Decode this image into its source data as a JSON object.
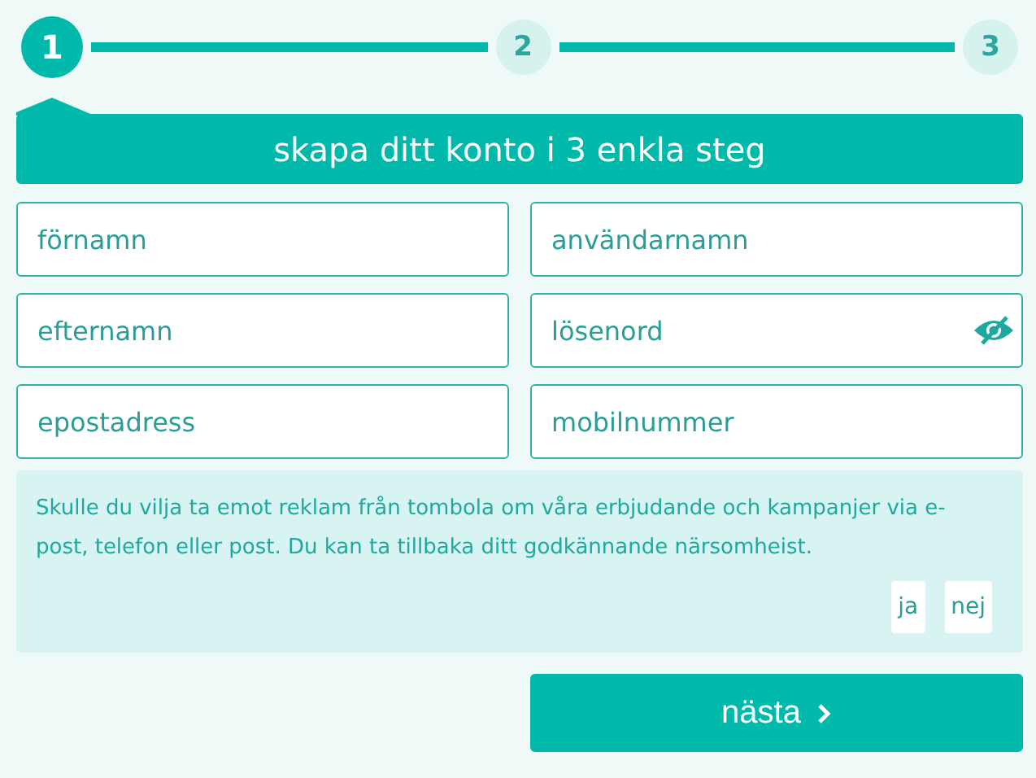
{
  "steps": [
    {
      "label": "1",
      "selected": true
    },
    {
      "label": "2",
      "selected": false
    },
    {
      "label": "3",
      "selected": false
    }
  ],
  "header": {
    "title": "skapa ditt konto i 3 enkla steg"
  },
  "fields": [
    {
      "placeholder": "förnamn",
      "kind": "text"
    },
    {
      "placeholder": "användarnamn",
      "kind": "text"
    },
    {
      "placeholder": "efternamn",
      "kind": "text"
    },
    {
      "placeholder": "lösenord",
      "kind": "password"
    },
    {
      "placeholder": "epostadress",
      "kind": "text"
    },
    {
      "placeholder": "mobilnummer",
      "kind": "text"
    }
  ],
  "consent": {
    "text": "Skulle du vilja ta emot reklam från tombola om våra erbjudande och kampanjer via e-post, telefon eller post. Du kan ta tillbaka ditt godkännande närsomheist.",
    "options": [
      {
        "label": "ja",
        "selected": false
      },
      {
        "label": "nej",
        "selected": false
      }
    ]
  },
  "next_button": {
    "label": "nästa"
  }
}
